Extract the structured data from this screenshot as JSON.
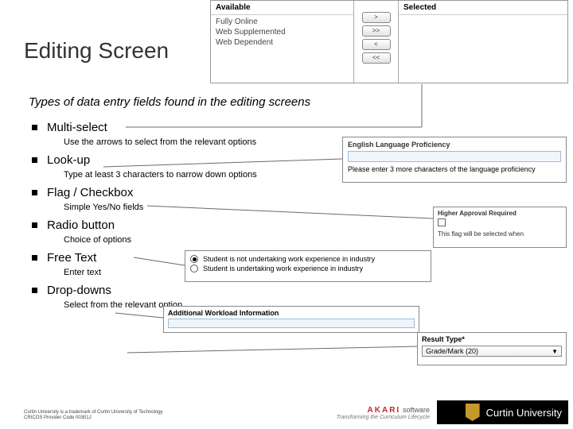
{
  "title": "Editing Screen",
  "subtitle": "Types of data entry fields found in the editing screens",
  "items": [
    {
      "label": "Multi-select",
      "desc": "Use the arrows to select from the relevant options"
    },
    {
      "label": "Look-up",
      "desc": "Type at least 3 characters to narrow down options"
    },
    {
      "label": "Flag / Checkbox",
      "desc": "Simple Yes/No fields"
    },
    {
      "label": "Radio button",
      "desc": "Choice of options"
    },
    {
      "label": "Free Text",
      "desc": "Enter text"
    },
    {
      "label": "Drop-downs",
      "desc": "Select from the relevant option"
    }
  ],
  "multiselect": {
    "available_header": "Available",
    "selected_header": "Selected",
    "options": [
      "Fully Online",
      "Web Supplemented",
      "Web Dependent"
    ],
    "buttons": [
      ">",
      ">>",
      "<",
      "<<"
    ]
  },
  "lookup": {
    "label": "English Language Proficiency",
    "hint": "Please enter 3 more characters of the language proficiency"
  },
  "checkbox": {
    "label": "Higher Approval Required",
    "note": "This flag will be selected when"
  },
  "radio": {
    "options": [
      {
        "label": "Student is not undertaking work experience in industry",
        "checked": true
      },
      {
        "label": "Student is undertaking work experience in industry",
        "checked": false
      }
    ]
  },
  "freetext": {
    "label": "Additional Workload Information"
  },
  "dropdown": {
    "label": "Result Type*",
    "value": "Grade/Mark (20)"
  },
  "footer": {
    "line1": "Curtin University is a trademark of Curtin University of Technology",
    "line2": "CRICOS Provider Code 00301J"
  },
  "logos": {
    "akari_brand": "AKARI",
    "akari_suffix": "software",
    "akari_tag": "Transforming the Curriculum Lifecycle",
    "curtin": "Curtin University"
  }
}
